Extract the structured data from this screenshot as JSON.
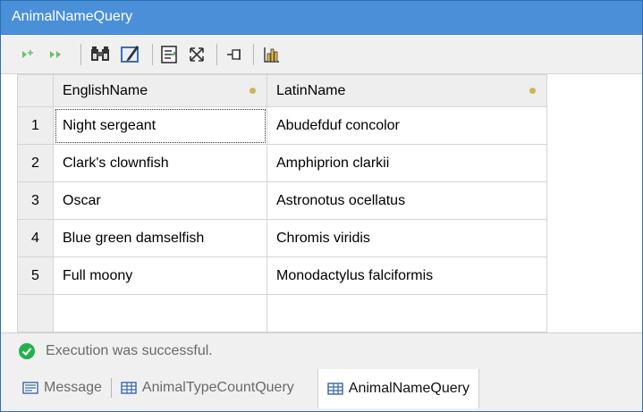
{
  "window": {
    "title": "AnimalNameQuery"
  },
  "toolbar": {
    "buttons": [
      "add-row-icon",
      "next-icon",
      "find-icon",
      "edit-icon",
      "copy-icon",
      "resize-icon",
      "pin-icon",
      "chart-icon"
    ]
  },
  "grid": {
    "columns": [
      "EnglishName",
      "LatinName"
    ],
    "rows": [
      {
        "num": "1",
        "english": "Night sergeant",
        "latin": "Abudefduf concolor"
      },
      {
        "num": "2",
        "english": "Clark's clownfish",
        "latin": "Amphiprion clarkii"
      },
      {
        "num": "3",
        "english": "Oscar",
        "latin": "Astronotus ocellatus"
      },
      {
        "num": "4",
        "english": "Blue green damselfish",
        "latin": "Chromis viridis"
      },
      {
        "num": "5",
        "english": "Full moony",
        "latin": "Monodactylus falciformis"
      }
    ]
  },
  "status": {
    "text": "Execution was successful.",
    "color": "#22b24c"
  },
  "tabs": [
    {
      "label": "Message",
      "active": false
    },
    {
      "label": "AnimalTypeCountQuery",
      "active": false
    },
    {
      "label": "AnimalNameQuery",
      "active": true
    }
  ],
  "colors": {
    "title_bar": "#4a90d9",
    "accent_green": "#22b24c"
  }
}
